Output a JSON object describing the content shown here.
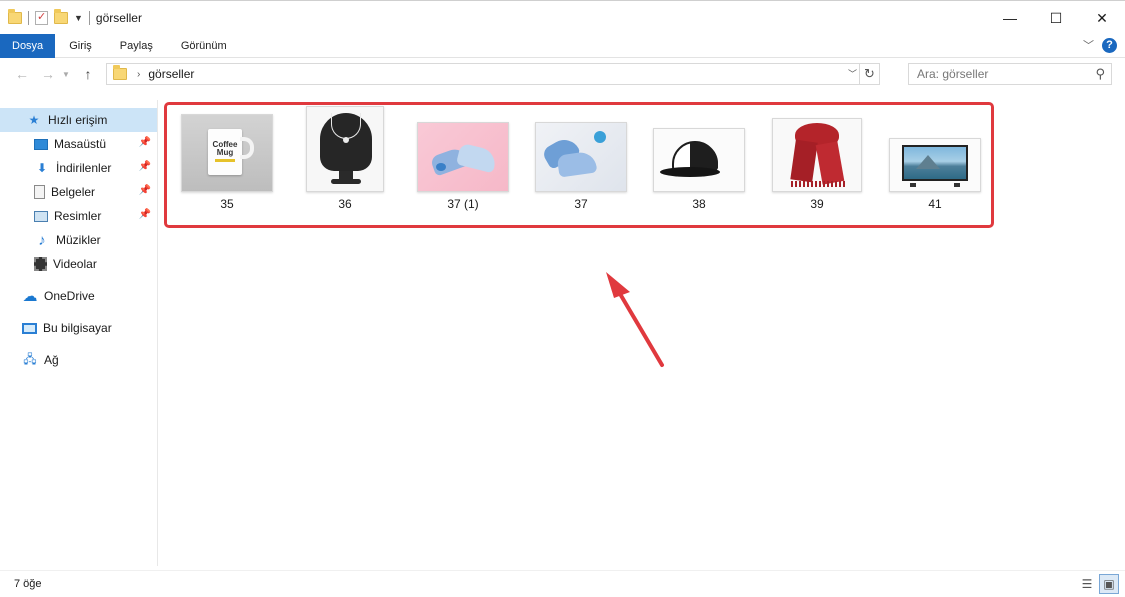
{
  "window": {
    "title": "görseller",
    "minimize": "—",
    "maximize": "☐",
    "close": "✕"
  },
  "ribbon": {
    "tabs": [
      "Dosya",
      "Giriş",
      "Paylaş",
      "Görünüm"
    ],
    "active_tab": "Dosya"
  },
  "address": {
    "breadcrumb": "görseller",
    "separator": "›",
    "search_placeholder": "Ara: görseller"
  },
  "sidebar": {
    "items": [
      {
        "label": "Hızlı erişim",
        "icon": "star-icon"
      },
      {
        "label": "Masaüstü",
        "icon": "desktop-icon",
        "pinned": true
      },
      {
        "label": "İndirilenler",
        "icon": "download-icon",
        "pinned": true
      },
      {
        "label": "Belgeler",
        "icon": "document-icon",
        "pinned": true
      },
      {
        "label": "Resimler",
        "icon": "pictures-icon",
        "pinned": true
      },
      {
        "label": "Müzikler",
        "icon": "music-icon"
      },
      {
        "label": "Videolar",
        "icon": "video-icon"
      },
      {
        "label": "OneDrive",
        "icon": "cloud-icon"
      },
      {
        "label": "Bu bilgisayar",
        "icon": "computer-icon"
      },
      {
        "label": "Ağ",
        "icon": "network-icon"
      }
    ]
  },
  "files": [
    {
      "name": "35",
      "thumbnail": "coffee-mug",
      "mug_text_1": "Coffee",
      "mug_text_2": "Mug"
    },
    {
      "name": "36",
      "thumbnail": "necklace-on-bust"
    },
    {
      "name": "37 (1)",
      "thumbnail": "baby-shoes-pink"
    },
    {
      "name": "37",
      "thumbnail": "baby-shoes-white"
    },
    {
      "name": "38",
      "thumbnail": "trucker-cap"
    },
    {
      "name": "39",
      "thumbnail": "red-scarf"
    },
    {
      "name": "41",
      "thumbnail": "television"
    }
  ],
  "status": {
    "item_count": "7 öğe"
  },
  "colors": {
    "accent": "#1a68bf",
    "highlight": "#e0393e",
    "selected": "#cce4f7"
  }
}
